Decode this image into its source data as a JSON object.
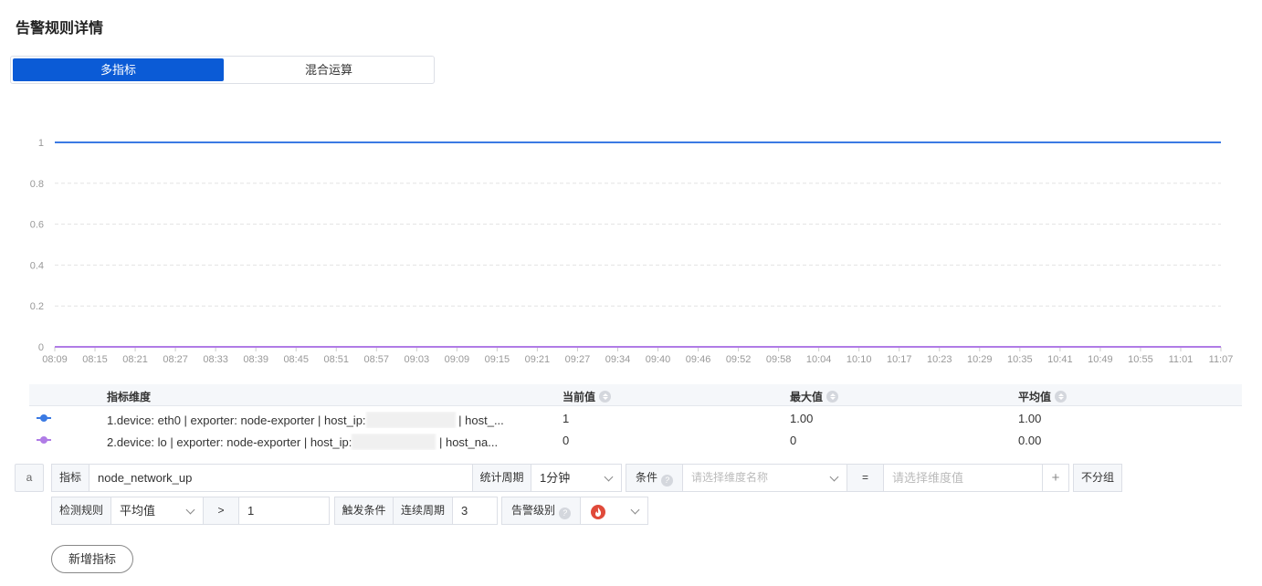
{
  "page": {
    "title": "告警规则详情"
  },
  "mode_tabs": {
    "multi": "多指标",
    "mixed": "混合运算",
    "active": "多指标"
  },
  "chart_data": {
    "type": "line",
    "x": [
      "08:09",
      "08:15",
      "08:21",
      "08:27",
      "08:33",
      "08:39",
      "08:45",
      "08:51",
      "08:57",
      "09:03",
      "09:09",
      "09:15",
      "09:21",
      "09:27",
      "09:34",
      "09:40",
      "09:46",
      "09:52",
      "09:58",
      "10:04",
      "10:10",
      "10:17",
      "10:23",
      "10:29",
      "10:35",
      "10:41",
      "10:49",
      "10:55",
      "11:01",
      "11:07"
    ],
    "y_ticks": [
      "0",
      "0.2",
      "0.4",
      "0.6",
      "0.8",
      "1"
    ],
    "ylim": [
      0,
      1
    ],
    "grid": true,
    "series": [
      {
        "color": "#3b7ae3",
        "values": [
          1,
          1,
          1,
          1,
          1,
          1,
          1,
          1,
          1,
          1,
          1,
          1,
          1,
          1,
          1,
          1,
          1,
          1,
          1,
          1,
          1,
          1,
          1,
          1,
          1,
          1,
          1,
          1,
          1,
          1
        ]
      },
      {
        "color": "#b07ce6",
        "values": [
          0,
          0,
          0,
          0,
          0,
          0,
          0,
          0,
          0,
          0,
          0,
          0,
          0,
          0,
          0,
          0,
          0,
          0,
          0,
          0,
          0,
          0,
          0,
          0,
          0,
          0,
          0,
          0,
          0,
          0
        ]
      }
    ]
  },
  "legend_table": {
    "headers": {
      "dimension": "指标维度",
      "current": "当前值",
      "max": "最大值",
      "avg": "平均值"
    },
    "rows": [
      {
        "color": "#3b7ae3",
        "dim_prefix": "1.device: eth0 | exporter: node-exporter | host_ip:",
        "dim_suffix": "| host_...",
        "current": "1",
        "max": "1.00",
        "avg": "1.00"
      },
      {
        "color": "#b07ce6",
        "dim_prefix": "2.device: lo | exporter: node-exporter | host_ip:",
        "dim_suffix": "| host_na...",
        "current": "0",
        "max": "0",
        "avg": "0.00"
      }
    ]
  },
  "metric_row": {
    "alias": "a",
    "metric_label": "指标",
    "metric_value": "node_network_up",
    "period_label": "统计周期",
    "period_value": "1分钟",
    "condition_label": "条件",
    "dim_name_placeholder": "请选择维度名称",
    "equals": "=",
    "dim_value_placeholder": "请选择维度值",
    "plus": "+",
    "group_button": "不分组"
  },
  "rule_row": {
    "detect_label": "检测规则",
    "method_value": "平均值",
    "operator": ">",
    "threshold_value": "1",
    "trigger_label": "触发条件",
    "consecutive_label": "连续周期",
    "consecutive_value": "3",
    "level_label": "告警级别",
    "level_icon": "fire-icon",
    "level_color": "#e04a3a"
  },
  "add_metric": {
    "label": "新增指标"
  }
}
